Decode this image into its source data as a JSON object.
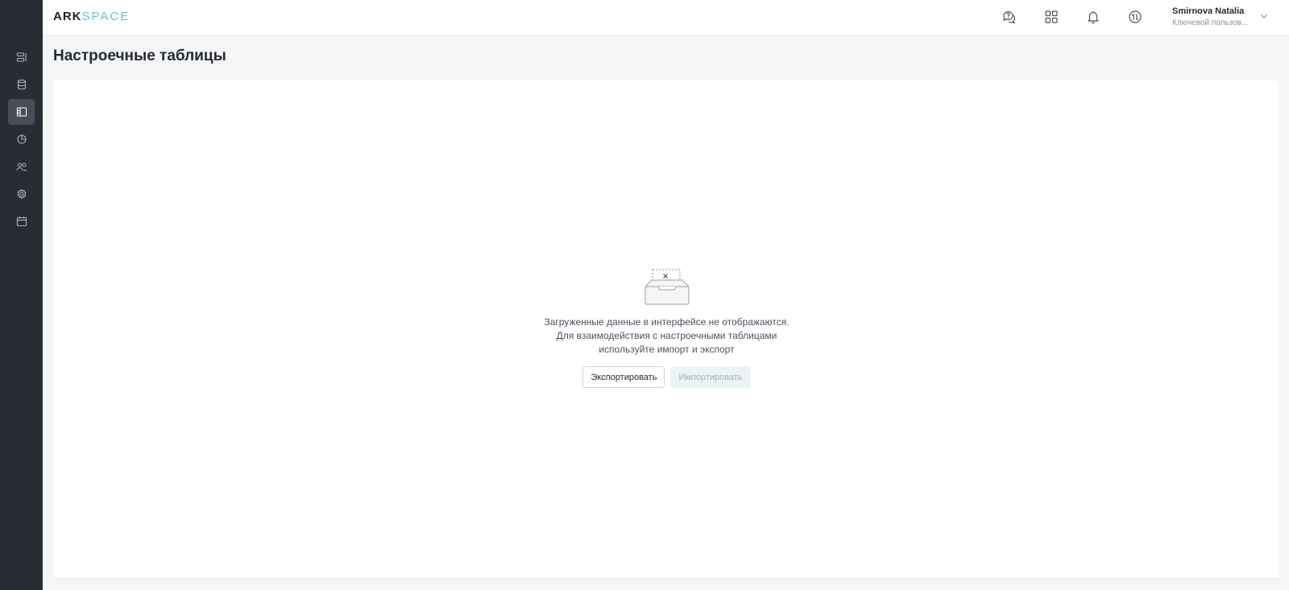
{
  "app": {
    "logo_primary": "ARK",
    "logo_secondary": "SPACE",
    "accent_color": "#5cc6d6",
    "sidebar_bg": "#2a2c33"
  },
  "sidebar": {
    "items": [
      {
        "icon": "dashboard-icon",
        "active": false
      },
      {
        "icon": "database-icon",
        "active": false
      },
      {
        "icon": "table-settings-icon",
        "active": true
      },
      {
        "icon": "pie-chart-icon",
        "active": false
      },
      {
        "icon": "users-icon",
        "active": false
      },
      {
        "icon": "gear-icon",
        "active": false
      },
      {
        "icon": "calendar-icon",
        "active": false
      }
    ]
  },
  "header": {
    "icons": [
      "help-chat-icon",
      "apps-grid-icon",
      "bell-icon",
      "sync-icon"
    ],
    "user": {
      "name": "Smirnova Natalia",
      "role": "Ключевой пользов..."
    }
  },
  "page": {
    "title": "Настроечные таблицы"
  },
  "empty_state": {
    "icon": "empty-box-icon",
    "lines": [
      "Загруженные данные в интерфейсе не отображаются.",
      "Для взаимодействия с настроечными таблицами",
      "используйте импорт и экспорт"
    ],
    "export_label": "Экспортировать",
    "import_label": "Импортировать"
  }
}
